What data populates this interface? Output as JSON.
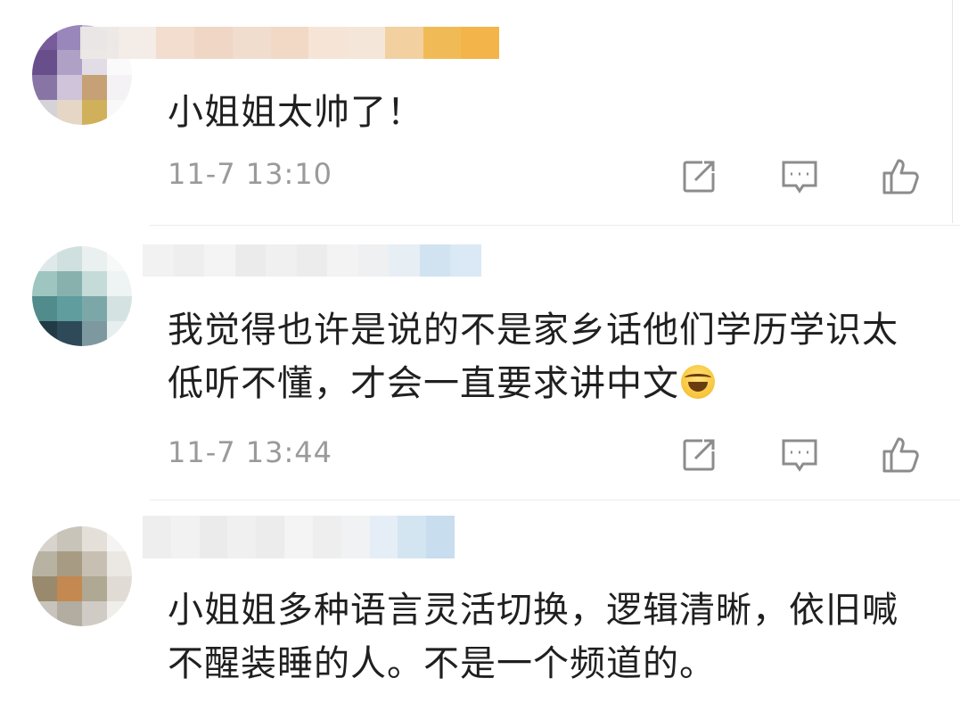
{
  "comments": [
    {
      "text": "小姐姐太帅了！",
      "time": "11-7 13:10",
      "avatar_colors": [
        "#7a5aa0",
        "#9a86c0",
        "#c8bcd8",
        "#f1eef4",
        "#6a4e92",
        "#b0a0c8",
        "#e2dce8",
        "#fafafa",
        "#8a74aa",
        "#d0c4dc",
        "#c8a070",
        "#f5f2f5",
        "#d6d2da",
        "#e8d6c4",
        "#d4b050",
        "#f8f8f8"
      ],
      "name_colors": [
        "#ece8e6",
        "#f4ece6",
        "#f2dccd",
        "#f0d4c2",
        "#f1dccc",
        "#f1d8c4",
        "#f6e4d4",
        "#f4e6d8",
        "#f2ce9a",
        "#f0b84e",
        "#f3b040"
      ]
    },
    {
      "text": "我觉得也许是说的不是家乡话他们学历学识太低听不懂，才会一直要求讲中文",
      "time": "11-7 13:44",
      "avatar_colors": [
        "#dfe9ea",
        "#cfe0df",
        "#e8f0ef",
        "#f7f9f9",
        "#9cc6c0",
        "#84b2ae",
        "#c2dcd8",
        "#eef4f3",
        "#4c8c8e",
        "#5a9ea0",
        "#78a8aa",
        "#d4e2e2",
        "#1f3a48",
        "#2c4a5a",
        "#7a9aa0",
        "#e6eeee"
      ],
      "name_colors": [
        "#f2f2f2",
        "#eeeeee",
        "#f4f4f4",
        "#eaeaea",
        "#f0f0f0",
        "#ececec",
        "#f3f3f3",
        "#eef0f2",
        "#e6eef4",
        "#cfe2f0",
        "#d8e8f4"
      ]
    },
    {
      "text": "小姐姐多种语言灵活切换，逻辑清晰，依旧喊不醒装睡的人。不是一个频道的。",
      "time": "",
      "avatar_colors": [
        "#d8d4cc",
        "#c8c4b8",
        "#e4e0d8",
        "#f5f4f2",
        "#b8b2a0",
        "#a89c80",
        "#c8c0b0",
        "#ebe8e2",
        "#9a8a6a",
        "#c8884a",
        "#b0a890",
        "#e0dcd4",
        "#c8c4bc",
        "#b4aca0",
        "#d0ccc4",
        "#f0eeea"
      ],
      "name_colors": [
        "#eeeeee",
        "#f2f2f2",
        "#eaeaea",
        "#f0f0f0",
        "#ececec",
        "#f4f4f4",
        "#eeeeee",
        "#f0f2f4",
        "#e4eef6",
        "#d2e4f2",
        "#c6dcee"
      ]
    }
  ],
  "icons": {
    "share": "share-icon",
    "reply": "comment-icon",
    "like": "thumbs-up-icon"
  }
}
